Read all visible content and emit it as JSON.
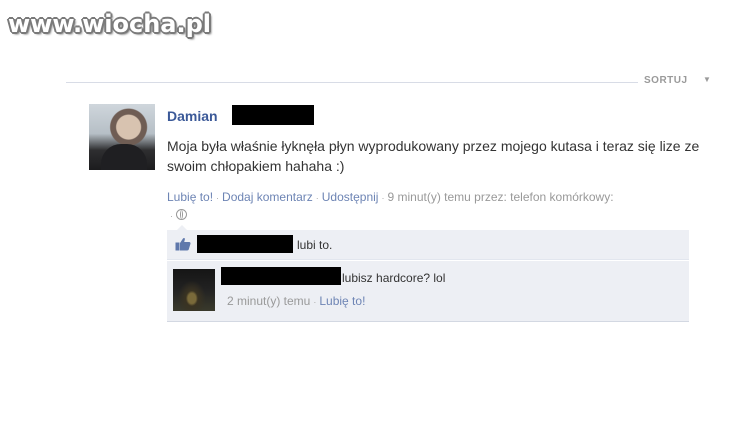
{
  "watermark": {
    "text": "www.wiocha.pl"
  },
  "sort": {
    "label": "SORTUJ",
    "arrow": "▼"
  },
  "post": {
    "author_first": "Damian",
    "text": "Moja była właśnie łyknęła płyn wyprodukowany przez mojego kutasa i teraz się lize ze swoim chłopakiem hahaha :)",
    "meta": {
      "like_label": "Lubię to!",
      "comment_label": "Dodaj komentarz",
      "share_label": "Udostępnij",
      "time_text": "9 minut(y) temu przez: telefon komórkowy:",
      "separator": "·",
      "privacy_icon": "globe-icon"
    }
  },
  "likes": {
    "text": "lubi to.",
    "icon": "thumbs-up-icon"
  },
  "comment": {
    "text": "lubisz hardcore? lol",
    "time": "2 minut(y) temu",
    "like_label": "Lubię to!"
  },
  "colors": {
    "link": "#3b5998",
    "link_light": "#6d84b4",
    "ufi_bg": "#edeff4",
    "meta_grey": "#999999"
  }
}
